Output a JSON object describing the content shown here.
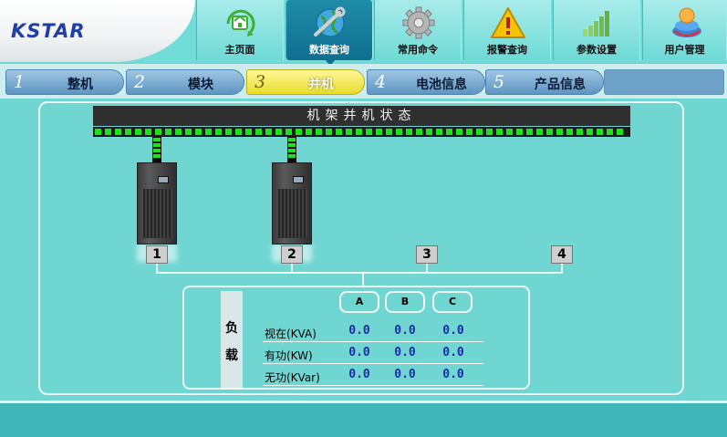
{
  "app": {
    "logo": "KSTAR"
  },
  "nav": [
    {
      "label": "主页面",
      "icon": "home-icon"
    },
    {
      "label": "数据查询",
      "icon": "globe-wrench-icon",
      "active": true
    },
    {
      "label": "常用命令",
      "icon": "gear-icon"
    },
    {
      "label": "报警查询",
      "icon": "warning-icon"
    },
    {
      "label": "参数设置",
      "icon": "bar-chart-icon"
    },
    {
      "label": "用户管理",
      "icon": "users-icon"
    }
  ],
  "tabs": [
    {
      "num": "1",
      "label": "整机"
    },
    {
      "num": "2",
      "label": "模块"
    },
    {
      "num": "3",
      "label": "并机",
      "active": true
    },
    {
      "num": "4",
      "label": "电池信息"
    },
    {
      "num": "5",
      "label": "产品信息"
    }
  ],
  "parallel": {
    "title": "机架并机状态",
    "units": [
      "1",
      "2",
      "3",
      "4"
    ],
    "online": [
      true,
      true,
      false,
      false
    ]
  },
  "load": {
    "side_label_top": "负",
    "side_label_bottom": "载",
    "phases": [
      "A",
      "B",
      "C"
    ],
    "rows": [
      {
        "label": "视在(KVA)",
        "values": [
          "0.0",
          "0.0",
          "0.0"
        ]
      },
      {
        "label": "有功(KW)",
        "values": [
          "0.0",
          "0.0",
          "0.0"
        ]
      },
      {
        "label": "无功(KVar)",
        "values": [
          "0.0",
          "0.0",
          "0.0"
        ]
      }
    ]
  },
  "colors": {
    "background": "#6fd6d2",
    "bus_led": "#19e619",
    "value_text": "#1a2aa8",
    "active_tab": "#e8dc2a",
    "active_nav": "#0f6f90"
  }
}
